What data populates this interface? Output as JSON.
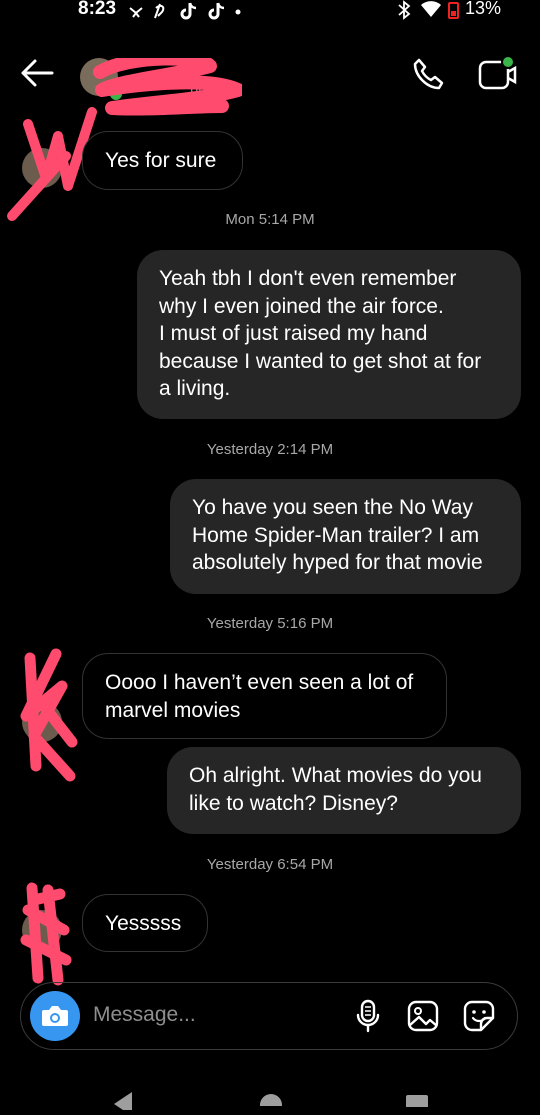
{
  "status_bar": {
    "time": "8:23",
    "battery": "13%"
  },
  "header": {
    "activity": "now"
  },
  "messages": [
    {
      "text": "Yes for sure"
    },
    {
      "timestamp": "Mon 5:14 PM"
    },
    {
      "text": "Yeah tbh I don't even remember\nwhy I even joined the air force.\nI must of just raised my hand\nbecause I wanted to get shot at for\na living."
    },
    {
      "timestamp": "Yesterday 2:14 PM"
    },
    {
      "text": "Yo have you seen the No Way\nHome Spider-Man trailer? I am\nabsolutely hyped for that movie"
    },
    {
      "timestamp": "Yesterday 5:16 PM"
    },
    {
      "text": "Oooo I haven’t even seen a lot of\nmarvel movies"
    },
    {
      "text": "Oh alright. What movies do you\nlike to watch? Disney?"
    },
    {
      "timestamp": "Yesterday 6:54 PM"
    },
    {
      "text": "Yesssss"
    }
  ],
  "composer": {
    "placeholder": "Message..."
  },
  "colors": {
    "background": "#000000",
    "outgoing_bubble": "#262626",
    "camera_button": "#3797f0",
    "redaction": "#ff4b6e",
    "online": "#3bb54a"
  }
}
